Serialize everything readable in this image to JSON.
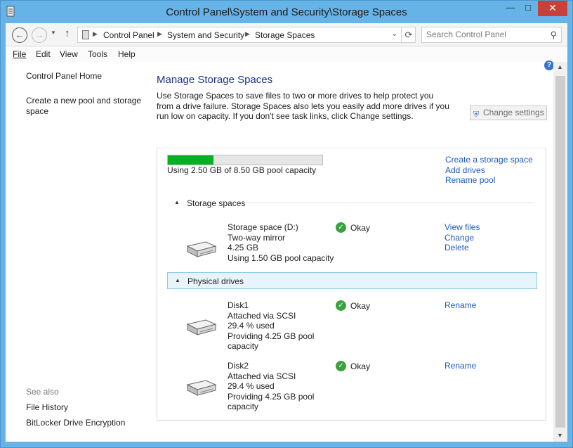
{
  "window": {
    "title": "Control Panel\\System and Security\\Storage Spaces",
    "minimize_glyph": "—",
    "maximize_glyph": "□",
    "close_glyph": "✕"
  },
  "nav": {
    "breadcrumbs": [
      "Control Panel",
      "System and Security",
      "Storage Spaces"
    ],
    "search_placeholder": "Search Control Panel"
  },
  "menu": [
    "File",
    "Edit",
    "View",
    "Tools",
    "Help"
  ],
  "sidebar": {
    "home": "Control Panel Home",
    "create_pool": "Create a new pool and storage space",
    "see_also_label": "See also",
    "see_also": [
      "File History",
      "BitLocker Drive Encryption"
    ]
  },
  "main": {
    "title": "Manage Storage Spaces",
    "description": "Use Storage Spaces to save files to two or more drives to help protect you from a drive failure. Storage Spaces also lets you easily add more drives if you run low on capacity. If you don't see task links, click Change settings.",
    "change_settings": "Change settings"
  },
  "pool": {
    "used_fraction": 0.294,
    "usage_text": "Using 2.50 GB of 8.50 GB pool capacity",
    "links": [
      "Create a storage space",
      "Add drives",
      "Rename pool"
    ]
  },
  "storage_spaces": {
    "heading": "Storage spaces",
    "items": [
      {
        "name": "Storage space (D:)",
        "type": "Two-way mirror",
        "size": "4.25 GB",
        "usage": "Using 1.50 GB pool capacity",
        "status": "Okay",
        "links": [
          "View files",
          "Change",
          "Delete"
        ]
      }
    ]
  },
  "physical_drives": {
    "heading": "Physical drives",
    "items": [
      {
        "name": "Disk1",
        "attached": "Attached via SCSI",
        "used": "29.4 % used",
        "providing_1": "Providing 4.25 GB pool",
        "providing_2": "capacity",
        "status": "Okay",
        "link": "Rename"
      },
      {
        "name": "Disk2",
        "attached": "Attached via SCSI",
        "used": "29.4 % used",
        "providing_1": "Providing 4.25 GB pool",
        "providing_2": "capacity",
        "status": "Okay",
        "link": "Rename"
      }
    ]
  },
  "icons": {
    "status_ok": "checkmark-icon",
    "drive": "hard-drive-icon",
    "help": "help-icon"
  },
  "colors": {
    "link": "#1e5bbd",
    "title": "#1e3287",
    "progress": "#06b025",
    "ok": "#3aa23f",
    "frame": "#66b3e8"
  }
}
